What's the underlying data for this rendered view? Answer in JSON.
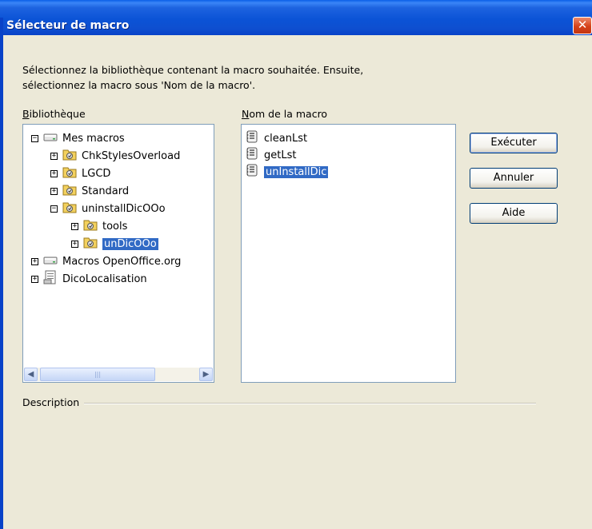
{
  "window": {
    "title": "Sélecteur de macro",
    "close_glyph": "✕"
  },
  "intro": {
    "line1": "Sélectionnez la bibliothèque contenant la macro souhaitée. Ensuite,",
    "line2": "sélectionnez la macro sous 'Nom de la macro'."
  },
  "library": {
    "label_mnemonic": "B",
    "label_rest": "ibliothèque",
    "tree": [
      {
        "label": "Mes macros",
        "expander": "−",
        "icon": "drive-icon",
        "selected": false
      },
      {
        "label": "ChkStylesOverload",
        "expander": "+",
        "icon": "library-folder-icon",
        "selected": false
      },
      {
        "label": "LGCD",
        "expander": "+",
        "icon": "library-folder-icon",
        "selected": false
      },
      {
        "label": "Standard",
        "expander": "+",
        "icon": "library-folder-icon",
        "selected": false
      },
      {
        "label": "uninstallDicOOo",
        "expander": "−",
        "icon": "library-folder-icon",
        "selected": false
      },
      {
        "label": "tools",
        "expander": "+",
        "icon": "library-folder-icon",
        "selected": false
      },
      {
        "label": "unDicOOo",
        "expander": "+",
        "icon": "library-folder-icon",
        "selected": true
      },
      {
        "label": "Macros OpenOffice.org",
        "expander": "+",
        "icon": "drive-icon",
        "selected": false
      },
      {
        "label": "DicoLocalisation",
        "expander": "+",
        "icon": "document-icon",
        "selected": false
      }
    ],
    "scroll_left": "◀",
    "scroll_right": "▶",
    "scroll_grip": "|||"
  },
  "macro_list": {
    "label_mnemonic": "N",
    "label_rest": "om de la macro",
    "items": [
      {
        "label": "cleanLst",
        "selected": false
      },
      {
        "label": "getLst",
        "selected": false
      },
      {
        "label": "unInstallDic",
        "selected": true
      }
    ]
  },
  "buttons": {
    "run": "Exécuter",
    "cancel": "Annuler",
    "help": "Aide"
  },
  "description": {
    "label": "Description"
  },
  "colors": {
    "title_bar": "#0B53D6",
    "selection": "#316AC5",
    "dialog_bg": "#ECE9D8"
  }
}
